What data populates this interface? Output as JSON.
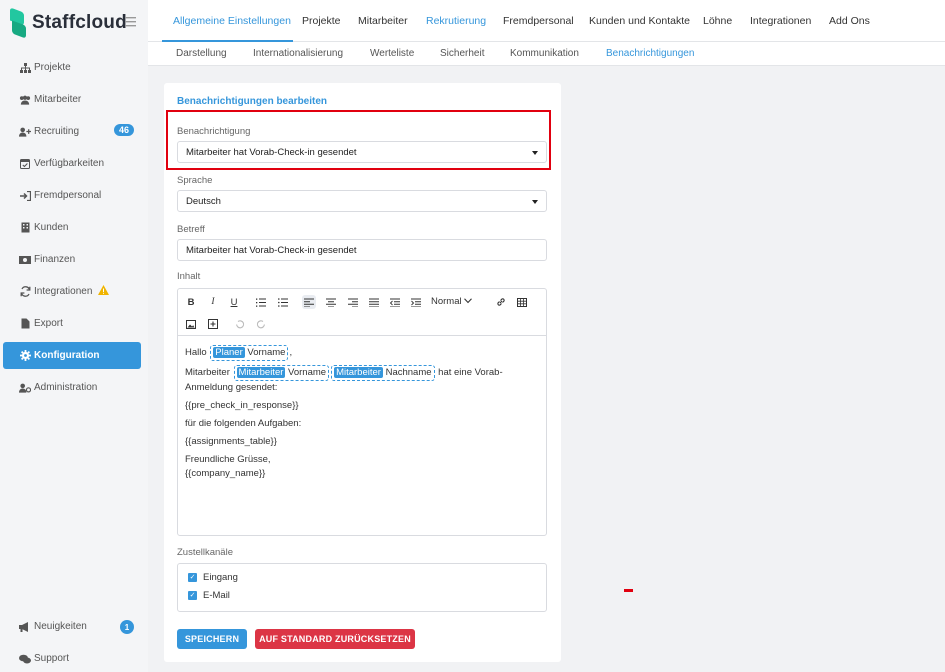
{
  "app": {
    "name": "Staffcloud"
  },
  "sidebar": {
    "items": [
      {
        "label": "Projekte",
        "icon": "sitemap-icon"
      },
      {
        "label": "Mitarbeiter",
        "icon": "users-icon"
      },
      {
        "label": "Recruiting",
        "icon": "user-plus-icon",
        "badge": "46"
      },
      {
        "label": "Verfügbarkeiten",
        "icon": "calendar-check-icon"
      },
      {
        "label": "Fremdpersonal",
        "icon": "sign-in-icon"
      },
      {
        "label": "Kunden",
        "icon": "building-icon"
      },
      {
        "label": "Finanzen",
        "icon": "money-icon"
      },
      {
        "label": "Integrationen",
        "icon": "sync-icon",
        "warning": true
      },
      {
        "label": "Export",
        "icon": "file-icon"
      },
      {
        "label": "Konfiguration",
        "icon": "gear-icon",
        "active": true
      },
      {
        "label": "Administration",
        "icon": "user-cog-icon"
      }
    ],
    "bottom": [
      {
        "label": "Neuigkeiten",
        "icon": "megaphone-icon",
        "badge": "1"
      },
      {
        "label": "Support",
        "icon": "support-icon"
      }
    ]
  },
  "topnav": {
    "tabs": [
      "Allgemeine Einstellungen",
      "Projekte",
      "Mitarbeiter",
      "Rekrutierung",
      "Fremdpersonal",
      "Kunden und Kontakte",
      "Löhne",
      "Integrationen",
      "Add Ons"
    ],
    "active": "Allgemeine Einstellungen"
  },
  "subnav": {
    "tabs": [
      "Darstellung",
      "Internationalisierung",
      "Werteliste",
      "Sicherheit",
      "Kommunikation",
      "Benachrichtigungen"
    ],
    "active": "Benachrichtigungen"
  },
  "form": {
    "title": "Benachrichtigungen bearbeiten",
    "notification_label": "Benachrichtigung",
    "notification_value": "Mitarbeiter hat Vorab-Check-in gesendet",
    "language_label": "Sprache",
    "language_value": "Deutsch",
    "subject_label": "Betreff",
    "subject_value": "Mitarbeiter hat Vorab-Check-in gesendet",
    "content_label": "Inhalt",
    "editor": {
      "style_select": "Normal",
      "greeting": "Hallo",
      "chip1_tag": "Planer",
      "chip1_field": "Vorname",
      "line2_prefix": "Mitarbeiter",
      "chip2_tag": "Mitarbeiter",
      "chip2_field": "Vorname",
      "chip3_tag": "Mitarbeiter",
      "chip3_field": "Nachname",
      "line2_suffix": "hat eine Vorab-Anmeldung gesendet:",
      "line3": "{{pre_check_in_response}}",
      "line4": "für die folgenden Aufgaben:",
      "line5": "{{assignments_table}}",
      "line6": "Freundliche Grüsse,",
      "line7": "{{company_name}}"
    },
    "channels_label": "Zustellkanäle",
    "channels": [
      {
        "label": "Eingang",
        "checked": true
      },
      {
        "label": "E-Mail",
        "checked": true
      }
    ],
    "save_label": "SPEICHERN",
    "reset_label": "AUF STANDARD ZURÜCKSETZEN"
  },
  "colors": {
    "accent": "#3596db",
    "danger": "#dc3545",
    "highlight": "#e1000f",
    "brand": "#22c7a0"
  }
}
